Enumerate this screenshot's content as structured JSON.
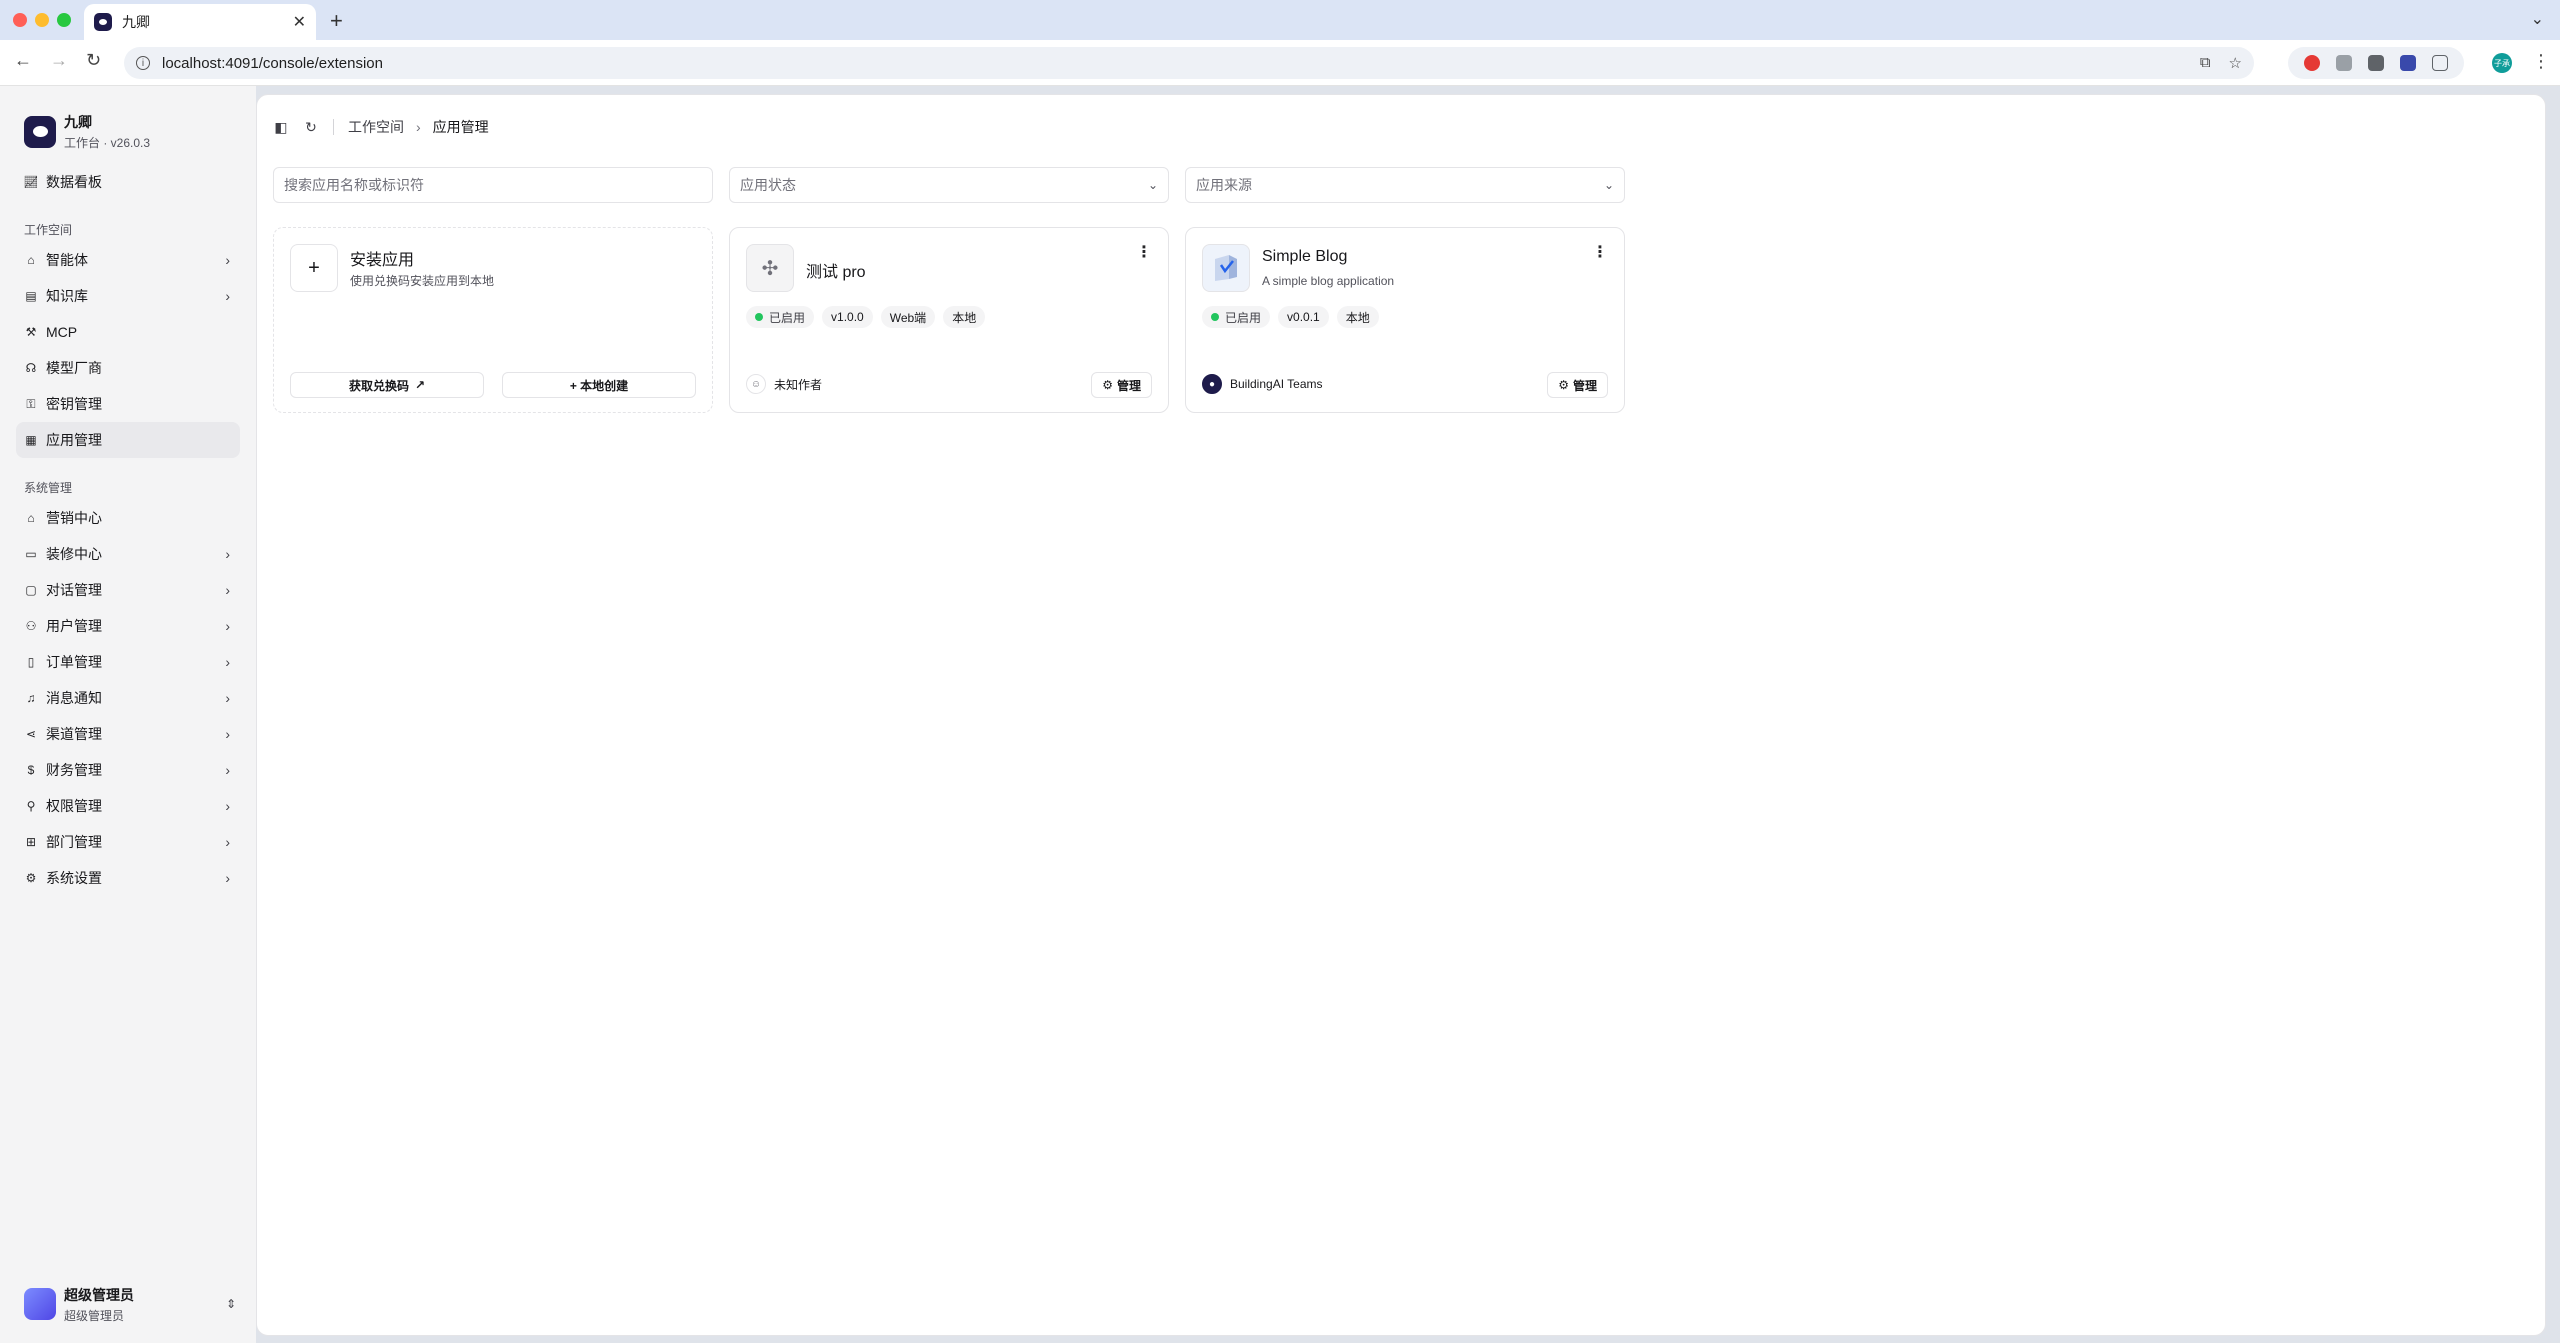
{
  "browser": {
    "tab_title": "九卿",
    "url": "localhost:4091/console/extension",
    "profile_initials": "子承"
  },
  "brand": {
    "name": "九卿",
    "subtitle": "工作台 · v26.0.3"
  },
  "sidebar": {
    "top_item": {
      "label": "数据看板",
      "icon": "chart-line-icon"
    },
    "workspace_section": "工作空间",
    "workspace_items": [
      {
        "label": "智能体",
        "icon": "bot-icon",
        "chevron": true
      },
      {
        "label": "知识库",
        "icon": "book-icon",
        "chevron": true
      },
      {
        "label": "MCP",
        "icon": "wrench-icon",
        "chevron": false
      },
      {
        "label": "模型厂商",
        "icon": "model-icon",
        "chevron": false
      },
      {
        "label": "密钥管理",
        "icon": "key-icon",
        "chevron": false
      },
      {
        "label": "应用管理",
        "icon": "grid-icon",
        "chevron": false,
        "active": true
      }
    ],
    "system_section": "系统管理",
    "system_items": [
      {
        "label": "营销中心",
        "icon": "store-icon",
        "chevron": false
      },
      {
        "label": "装修中心",
        "icon": "paint-roller-icon",
        "chevron": true
      },
      {
        "label": "对话管理",
        "icon": "message-icon",
        "chevron": true
      },
      {
        "label": "用户管理",
        "icon": "users-icon",
        "chevron": true
      },
      {
        "label": "订单管理",
        "icon": "clipboard-icon",
        "chevron": true
      },
      {
        "label": "消息通知",
        "icon": "bell-icon",
        "chevron": true
      },
      {
        "label": "渠道管理",
        "icon": "share-icon",
        "chevron": true
      },
      {
        "label": "财务管理",
        "icon": "dollar-icon",
        "chevron": true
      },
      {
        "label": "权限管理",
        "icon": "user-lock-icon",
        "chevron": true
      },
      {
        "label": "部门管理",
        "icon": "org-icon",
        "chevron": true
      },
      {
        "label": "系统设置",
        "icon": "settings-icon",
        "chevron": true
      }
    ],
    "user": {
      "name": "超级管理员",
      "role": "超级管理员"
    }
  },
  "breadcrumb": {
    "parent": "工作空间",
    "current": "应用管理"
  },
  "filters": {
    "search_placeholder": "搜索应用名称或标识符",
    "status_placeholder": "应用状态",
    "source_placeholder": "应用来源"
  },
  "install_card": {
    "title": "安装应用",
    "desc": "使用兑换码安装应用到本地",
    "redeem_label": "获取兑换码",
    "create_label": "+ 本地创建"
  },
  "apps": [
    {
      "name": "测试 pro",
      "desc": "",
      "status": "已启用",
      "version": "v1.0.0",
      "tags": [
        "Web端",
        "本地"
      ],
      "author": "未知作者",
      "manage_label": "管理"
    },
    {
      "name": "Simple Blog",
      "desc": "A simple blog application",
      "status": "已启用",
      "version": "v0.0.1",
      "tags": [
        "本地"
      ],
      "author": "BuildingAI Teams",
      "manage_label": "管理"
    }
  ],
  "colors": {
    "status_green": "#22c55e",
    "brand_dark": "#1e1b4b"
  }
}
